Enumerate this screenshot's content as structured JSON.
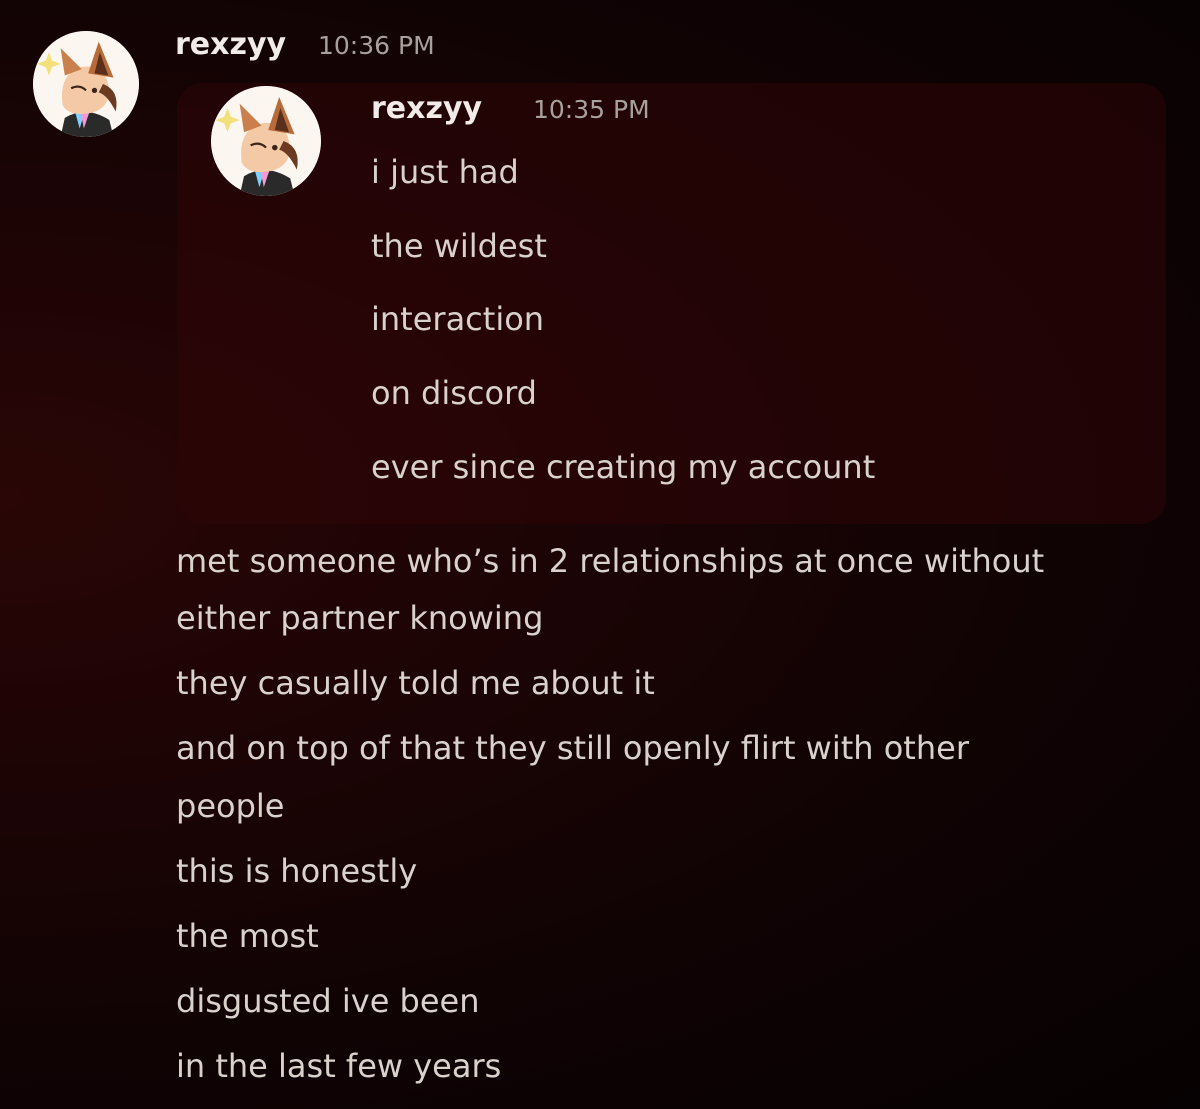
{
  "main_message": {
    "username": "rexzyy",
    "timestamp": "10:36 PM",
    "avatar_icon": "fox-avatar-icon",
    "quoted_message": {
      "username": "rexzyy",
      "timestamp": "10:35 PM",
      "avatar_icon": "fox-avatar-icon",
      "lines": [
        "i just had",
        "the wildest",
        "interaction",
        "on discord",
        "ever since creating my account"
      ]
    },
    "lines": [
      "met someone who’s in 2 relationships at once without",
      "either partner knowing",
      "they casually told me about it",
      "and on top of that they still openly flirt with other",
      "people",
      "this is honestly",
      "the most",
      "disgusted ive been",
      "in the last few years"
    ]
  },
  "colors": {
    "background": "#1d0405",
    "quote_card": "#300608",
    "username": "#f1ece8",
    "timestamp": "#a8a09c",
    "body_text": "#d8d1cc"
  }
}
